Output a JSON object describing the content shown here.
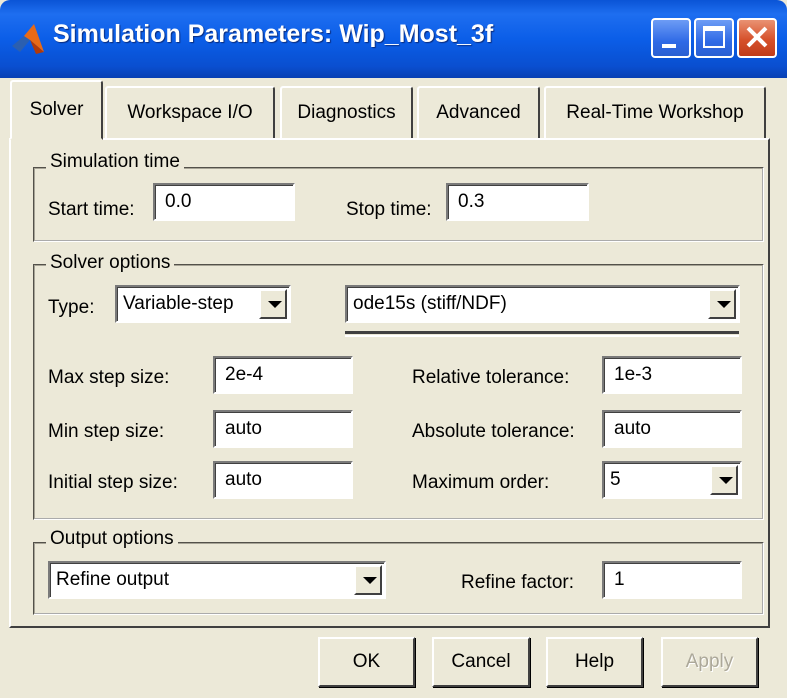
{
  "window": {
    "title": "Simulation Parameters: Wip_Most_3f",
    "icon": "matlab-icon"
  },
  "tabs": [
    {
      "label": "Solver",
      "active": true
    },
    {
      "label": "Workspace I/O",
      "active": false
    },
    {
      "label": "Diagnostics",
      "active": false
    },
    {
      "label": "Advanced",
      "active": false
    },
    {
      "label": "Real-Time Workshop",
      "active": false
    }
  ],
  "simulation_time": {
    "group_label": "Simulation time",
    "start_label": "Start time:",
    "start_value": "0.0",
    "stop_label": "Stop time:",
    "stop_value": "0.3"
  },
  "solver_options": {
    "group_label": "Solver options",
    "type_label": "Type:",
    "type_value": "Variable-step",
    "solver_value": "ode15s (stiff/NDF)",
    "max_step_label": "Max step size:",
    "max_step_value": "2e-4",
    "min_step_label": "Min step size:",
    "min_step_value": "auto",
    "initial_step_label": "Initial step size:",
    "initial_step_value": "auto",
    "rel_tol_label": "Relative tolerance:",
    "rel_tol_value": "1e-3",
    "abs_tol_label": "Absolute tolerance:",
    "abs_tol_value": "auto",
    "max_order_label": "Maximum order:",
    "max_order_value": "5"
  },
  "output_options": {
    "group_label": "Output options",
    "output_value": "Refine output",
    "refine_label": "Refine factor:",
    "refine_value": "1"
  },
  "buttons": {
    "ok": "OK",
    "cancel": "Cancel",
    "help": "Help",
    "apply": "Apply"
  },
  "colors": {
    "title_bar": "#0a54d6",
    "dialog_bg": "#ece9d8",
    "close_button": "#d6512b",
    "disabled_text": "#aca899"
  }
}
